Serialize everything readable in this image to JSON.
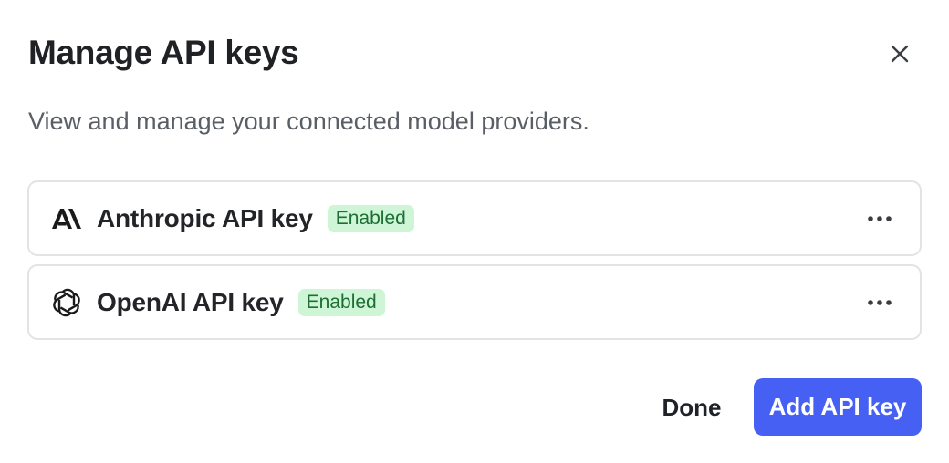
{
  "dialog": {
    "title": "Manage API keys",
    "description": "View and manage your connected model providers.",
    "close_icon": "close-icon"
  },
  "keys": [
    {
      "name": "Anthropic API key",
      "status": "Enabled",
      "icon": "anthropic-logo-icon"
    },
    {
      "name": "OpenAI API key",
      "status": "Enabled",
      "icon": "openai-logo-icon"
    }
  ],
  "footer": {
    "done_label": "Done",
    "add_label": "Add API key"
  },
  "colors": {
    "primary": "#4660f3",
    "badge_bg": "#cdf5d6",
    "badge_text": "#1c6e33",
    "border": "#e2e3e6"
  }
}
